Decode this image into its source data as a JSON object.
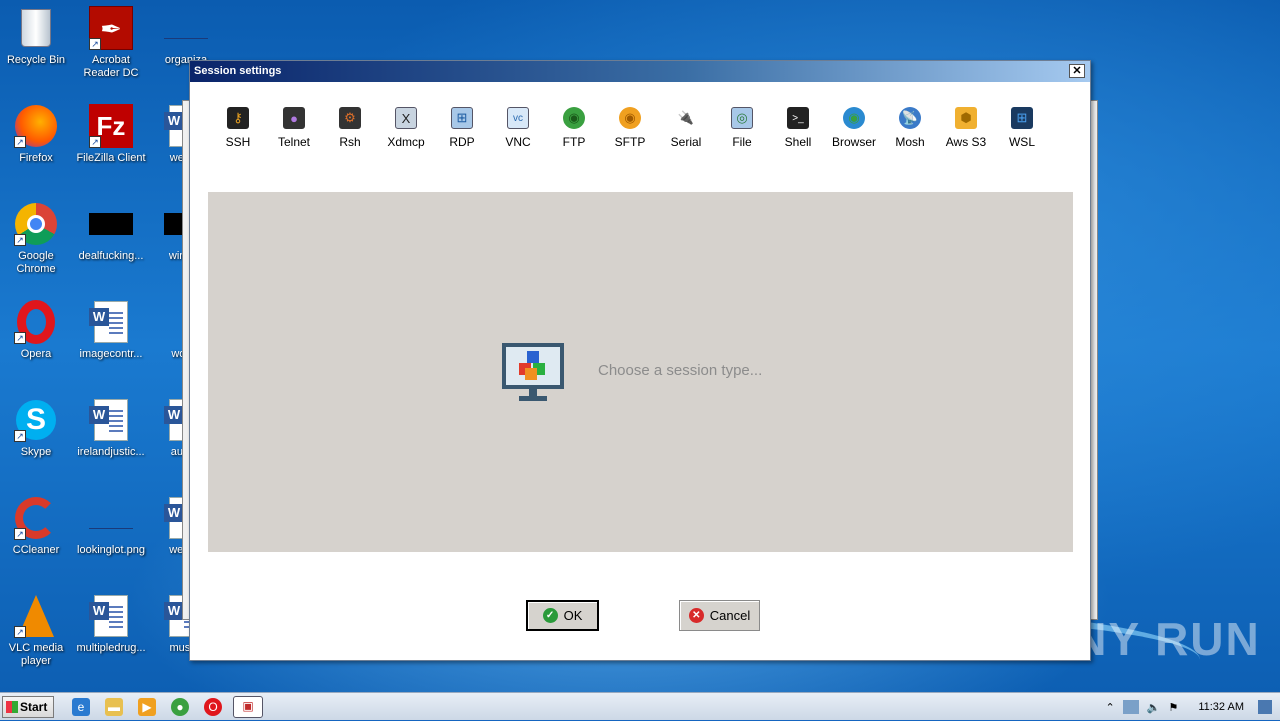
{
  "desktop": {
    "icons": [
      {
        "label": "Recycle Bin",
        "icon": "recycle-bin-icon"
      },
      {
        "label": "Acrobat Reader DC",
        "icon": "acrobat-icon"
      },
      {
        "label": "organiza",
        "icon": "file-icon"
      },
      {
        "label": "Firefox",
        "icon": "firefox-icon"
      },
      {
        "label": "FileZilla Client",
        "icon": "filezilla-icon"
      },
      {
        "label": "weann",
        "icon": "word-doc-icon"
      },
      {
        "label": "Google Chrome",
        "icon": "chrome-icon"
      },
      {
        "label": "dealfucking...",
        "icon": "black-file-icon"
      },
      {
        "label": "winexe",
        "icon": "black-file-icon"
      },
      {
        "label": "Opera",
        "icon": "opera-icon"
      },
      {
        "label": "imagecontr...",
        "icon": "word-doc-icon"
      },
      {
        "label": "woma",
        "icon": "file-icon"
      },
      {
        "label": "Skype",
        "icon": "skype-icon"
      },
      {
        "label": "irelandjustic...",
        "icon": "word-doc-icon"
      },
      {
        "label": "autom",
        "icon": "word-doc-icon"
      },
      {
        "label": "CCleaner",
        "icon": "ccleaner-icon"
      },
      {
        "label": "lookinglot.png",
        "icon": "image-icon"
      },
      {
        "label": "weekly",
        "icon": "word-doc-icon"
      },
      {
        "label": "VLC media player",
        "icon": "vlc-icon"
      },
      {
        "label": "multipledrug...",
        "icon": "word-doc-icon"
      },
      {
        "label": "museu",
        "icon": "word-doc-icon"
      }
    ]
  },
  "dialog": {
    "title": "Session settings",
    "close": "✕",
    "tools": [
      {
        "label": "SSH",
        "color": "#e8a020"
      },
      {
        "label": "Telnet",
        "color": "#7a3aa0"
      },
      {
        "label": "Rsh",
        "color": "#c0501a"
      },
      {
        "label": "Xdmcp",
        "color": "#6a7888"
      },
      {
        "label": "RDP",
        "color": "#2a7ac0"
      },
      {
        "label": "VNC",
        "color": "#3a9ad8"
      },
      {
        "label": "FTP",
        "color": "#3aa040"
      },
      {
        "label": "SFTP",
        "color": "#f0a020"
      },
      {
        "label": "Serial",
        "color": "#8a9aa8"
      },
      {
        "label": "File",
        "color": "#4a9ad0"
      },
      {
        "label": "Shell",
        "color": "#222222"
      },
      {
        "label": "Browser",
        "color": "#2a8ad0"
      },
      {
        "label": "Mosh",
        "color": "#3a7ac8"
      },
      {
        "label": "Aws S3",
        "color": "#f0b030"
      },
      {
        "label": "WSL",
        "color": "#1a5aa0"
      }
    ],
    "placeholder": "Choose a session type...",
    "ok_label": "OK",
    "cancel_label": "Cancel"
  },
  "taskbar": {
    "start_label": "Start",
    "clock": "11:32 AM"
  },
  "watermark": "ANY RUN"
}
